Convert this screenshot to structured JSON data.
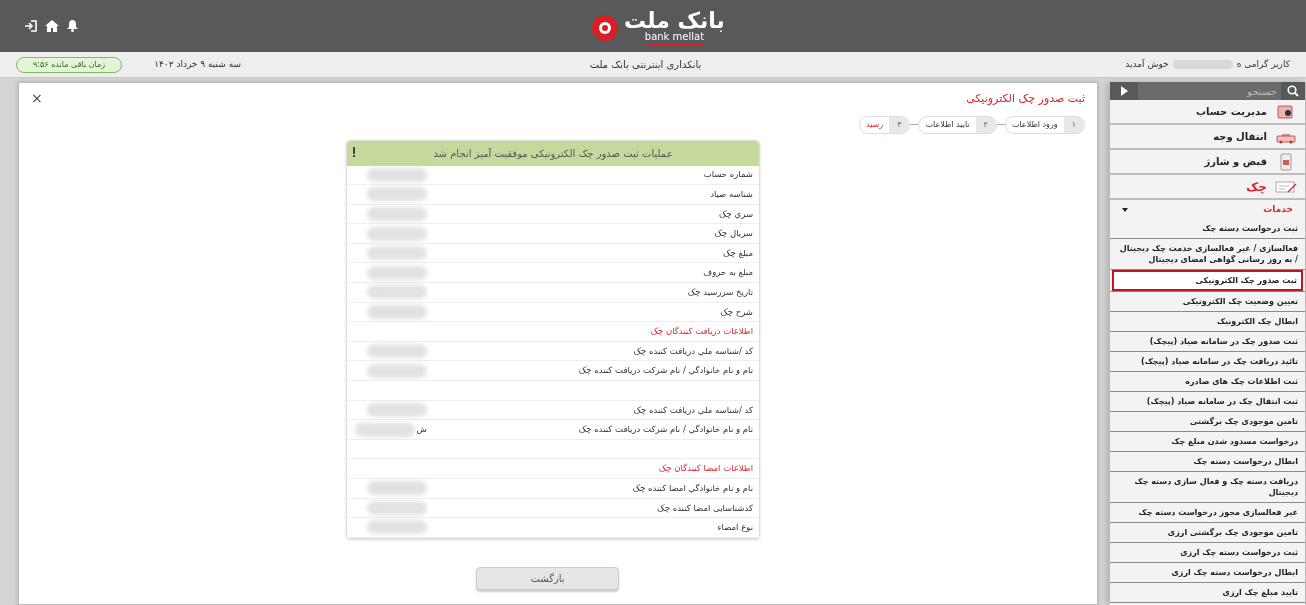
{
  "header": {
    "logo_text": "بانک ملت",
    "logo_subtext": "bank mellat"
  },
  "info_bar": {
    "greeting": "کاربر گرامی ه",
    "welcome": "خوش آمدید",
    "title": "بانکداری اینترنتی بانک ملت",
    "date": "سه شنبه ۹ خرداد ۱۴۰۲",
    "timer": "زمان باقی مانده ۹:۵۶"
  },
  "sidebar": {
    "search_placeholder": "جستجو",
    "groups": [
      {
        "label": "مدیریت حساب",
        "selected": false
      },
      {
        "label": "انتقال وجه",
        "selected": false
      },
      {
        "label": "قبض و شارژ",
        "selected": false
      },
      {
        "label": "چک",
        "selected": true
      }
    ],
    "submenu": {
      "label": "خدمات",
      "expanded": true,
      "items": [
        {
          "label": "ثبت درخواست دسته چک",
          "selected": false
        },
        {
          "label": "فعالسازی / غیر فعالسازی خدمت چک دیجیتال / به روز رسانی گواهی امضای دیجیتال",
          "selected": false
        },
        {
          "label": "ثبت صدور چک الکترونیکی",
          "selected": true
        },
        {
          "label": "تعیین وضعیت چک الکترونیکی",
          "selected": false
        },
        {
          "label": "ابطال چک الکترونیک",
          "selected": false
        },
        {
          "label": "ثبت صدور چک در سامانه صیاد (پیچک)",
          "selected": false
        },
        {
          "label": "تائید دریافت چک در سامانه صیاد (پیچک)",
          "selected": false
        },
        {
          "label": "ثبت اطلاعات چک های صادره",
          "selected": false
        },
        {
          "label": "ثبت انتقال چک در سامانه صیاد (پیچک)",
          "selected": false
        },
        {
          "label": "تامین موجودی چک برگشتی",
          "selected": false
        },
        {
          "label": "درخواست مسدود شدن مبلغ چک",
          "selected": false
        },
        {
          "label": "ابطال درخواست دسته چک",
          "selected": false
        },
        {
          "label": "دریافت دسته چک و فعال سازی دسته چک دیجیتال",
          "selected": false
        },
        {
          "label": "غیر فعالسازی مجوز درخواست دسته چک",
          "selected": false
        },
        {
          "label": "تامین موجودی چک برگشتی ارزی",
          "selected": false
        },
        {
          "label": "ثبت درخواست دسته چک ارزی",
          "selected": false
        },
        {
          "label": "ابطال درخواست دسته چک ارزی",
          "selected": false
        },
        {
          "label": "تایید مبلغ چک ارزی",
          "selected": false
        }
      ]
    }
  },
  "page": {
    "title": "ثبت صدور چک الکترونیکی",
    "close": "×",
    "steps": [
      {
        "number": "۱",
        "label": "ورود اطلاعات",
        "selected": false
      },
      {
        "number": "۲",
        "label": "تایید اطلاعات",
        "selected": false
      },
      {
        "number": "۳",
        "label": "رسید",
        "selected": true
      }
    ],
    "result": {
      "message": "عملیات ثبت صدور چک الکترونیکی موفقیت آمیز انجام شد",
      "rows": [
        {
          "kind": "field",
          "label": "شماره حساب",
          "redacted": true
        },
        {
          "kind": "field",
          "label": "شناسه صیاد",
          "redacted": true
        },
        {
          "kind": "field",
          "label": "سري چک",
          "redacted": true
        },
        {
          "kind": "field",
          "label": "سريال چک",
          "redacted": true
        },
        {
          "kind": "field",
          "label": "مبلغ چک",
          "redacted": true
        },
        {
          "kind": "field",
          "label": "مبلغ به حروف",
          "redacted": true
        },
        {
          "kind": "field",
          "label": "تاریخ سررسید چک",
          "redacted": true
        },
        {
          "kind": "field",
          "label": "شرح چک",
          "redacted": true
        },
        {
          "kind": "section",
          "label": "اطلاعات دریافت کنندگان چک"
        },
        {
          "kind": "field",
          "label": "کد /شناسه ملي دریافت کننده چک",
          "redacted": true
        },
        {
          "kind": "field",
          "label": "نام و نام خانوادگي / نام شرکت دریافت کننده چک",
          "redacted": true
        },
        {
          "kind": "blank"
        },
        {
          "kind": "field",
          "label": "کد /شناسه ملي دریافت کننده چک",
          "redacted": true
        },
        {
          "kind": "field",
          "label": "نام و نام خانوادگي / نام شرکت دریافت کننده چک",
          "redacted": true,
          "value": "ش"
        },
        {
          "kind": "blank"
        },
        {
          "kind": "section",
          "label": "اطلاعات امضا کنندگان چک"
        },
        {
          "kind": "field",
          "label": "نام و نام خانوادگي امضا کننده چک",
          "redacted": true
        },
        {
          "kind": "field",
          "label": "کدشناسایی امضا کننده چک",
          "redacted": true
        },
        {
          "kind": "field",
          "label": "نوع امضاء",
          "redacted": true
        }
      ]
    },
    "back_button": "بازگشت"
  }
}
